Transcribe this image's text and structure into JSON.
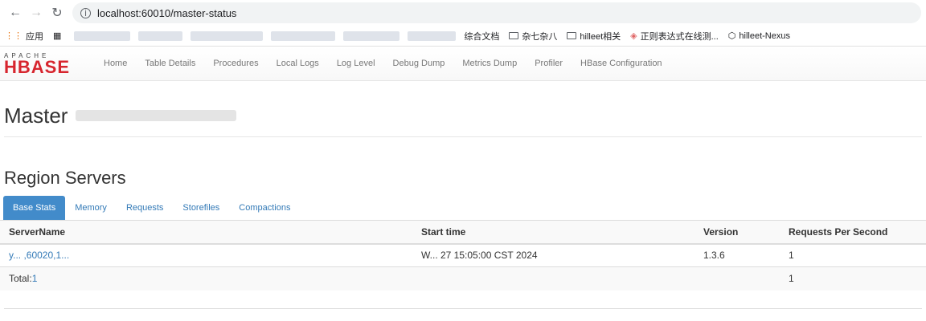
{
  "browser": {
    "url": "localhost:60010/master-status",
    "bookmarks": [
      {
        "icon": "apps-grid-icon",
        "label": "应用"
      },
      {
        "icon": "grid-icon",
        "label": ""
      },
      {
        "icon": "folder-icon",
        "label": "综合文档"
      },
      {
        "icon": "folder-icon",
        "label": "杂七杂八"
      },
      {
        "icon": "folder-icon",
        "label": "hilleet相关"
      },
      {
        "icon": "cube-icon",
        "label": "正则表达式在线测..."
      },
      {
        "icon": "hexagon-icon",
        "label": "hilleet-Nexus"
      }
    ]
  },
  "logo": {
    "top": "APACHE",
    "bottom": "HBASE"
  },
  "nav": [
    "Home",
    "Table Details",
    "Procedures",
    "Local Logs",
    "Log Level",
    "Debug Dump",
    "Metrics Dump",
    "Profiler",
    "HBase Configuration"
  ],
  "page": {
    "title": "Master"
  },
  "region_servers": {
    "heading": "Region Servers",
    "tabs": [
      "Base Stats",
      "Memory",
      "Requests",
      "Storefiles",
      "Compactions"
    ],
    "active_tab": "Base Stats",
    "columns": [
      "ServerName",
      "Start time",
      "Version",
      "Requests Per Second"
    ],
    "rows": [
      {
        "server_name": "y... ,60020,1...",
        "start_time": "W... 27 15:05:00 CST 2024",
        "version": "1.3.6",
        "rps": "1"
      }
    ],
    "total_label": "Total:",
    "total_count": "1",
    "total_rps": "1"
  }
}
